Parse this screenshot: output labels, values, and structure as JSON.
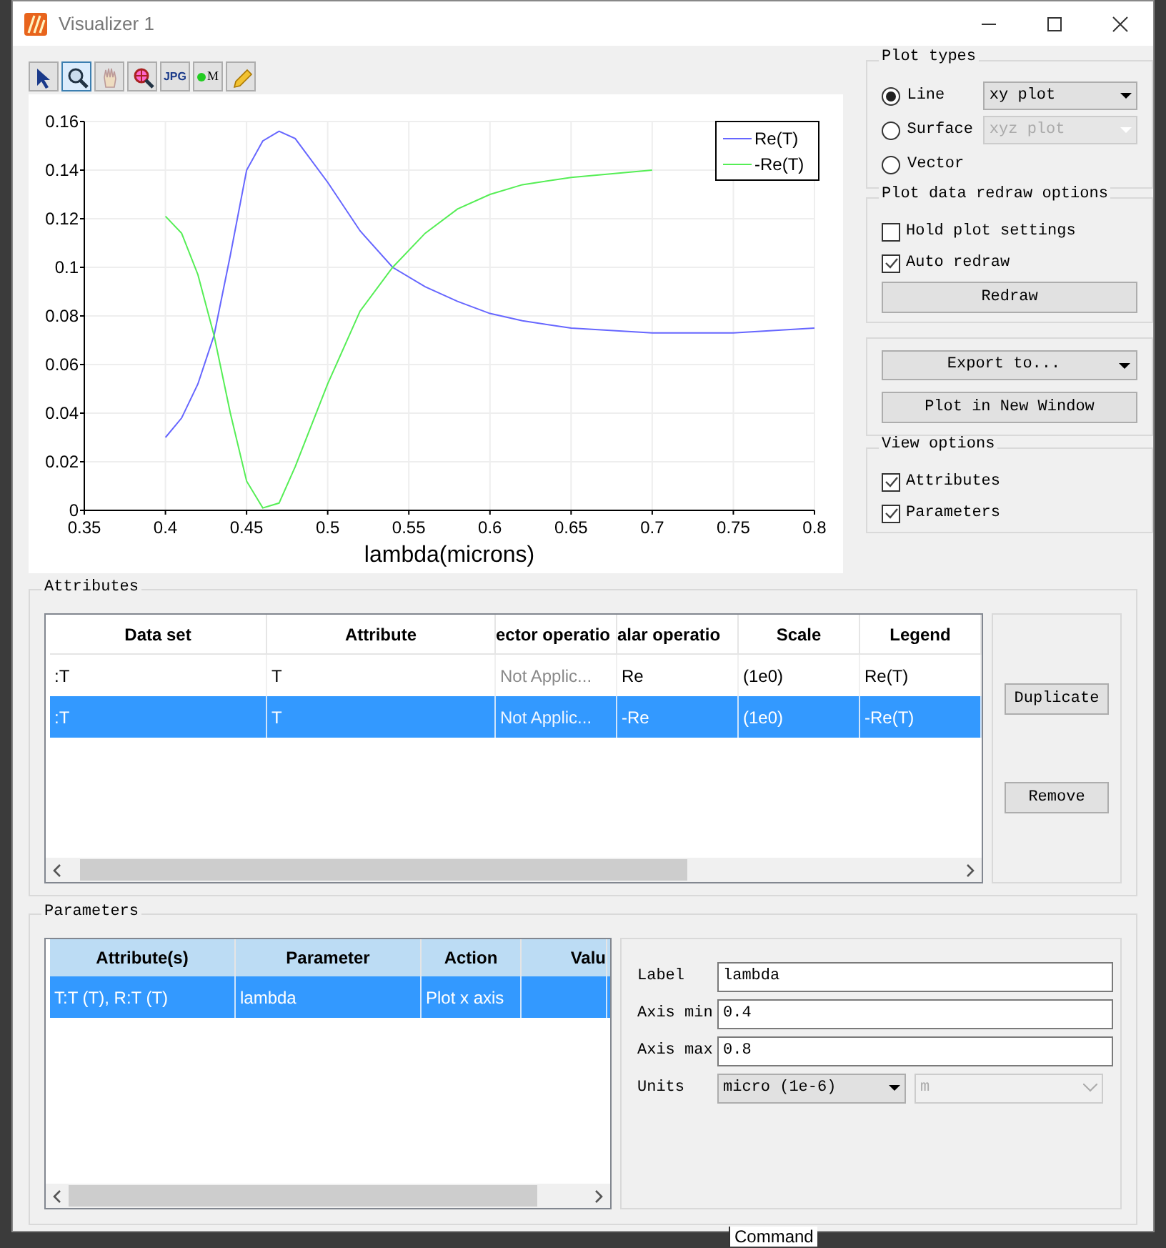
{
  "window": {
    "title": "Visualizer 1"
  },
  "toolbar": [
    {
      "kind": "pointer",
      "selected": false
    },
    {
      "kind": "zoom",
      "selected": true
    },
    {
      "kind": "pan",
      "selected": false
    },
    {
      "kind": "zoom-point",
      "selected": false
    },
    {
      "kind": "jpg",
      "label": "JPG",
      "selected": false
    },
    {
      "kind": "marker",
      "label": "M",
      "selected": false
    },
    {
      "kind": "pencil",
      "selected": false
    }
  ],
  "chart": {
    "chart_data": {
      "type": "line",
      "grid": true,
      "legend": true,
      "xlabel": "lambda(microns)",
      "xlim": [
        0.35,
        0.8
      ],
      "ylim": [
        0,
        0.16
      ],
      "xticks": [
        0.35,
        0.4,
        0.45,
        0.5,
        0.55,
        0.6,
        0.65,
        0.7,
        0.75,
        0.8
      ],
      "yticks": [
        0,
        0.02,
        0.04,
        0.06,
        0.08,
        0.1,
        0.12,
        0.14,
        0.16
      ],
      "x": [
        0.4,
        0.41,
        0.42,
        0.43,
        0.44,
        0.45,
        0.46,
        0.47,
        0.48,
        0.5,
        0.52,
        0.54,
        0.56,
        0.58,
        0.6,
        0.62,
        0.65,
        0.7,
        0.75,
        0.8
      ],
      "series": [
        {
          "name": "Re(T)",
          "color": "#6666ff",
          "values": [
            0.03,
            0.038,
            0.052,
            0.072,
            0.105,
            0.14,
            0.152,
            0.156,
            0.153,
            0.135,
            0.115,
            0.1,
            0.092,
            0.086,
            0.081,
            0.078,
            0.075,
            0.073,
            0.073,
            0.075
          ]
        },
        {
          "name": "-Re(T)",
          "color": "#55ee55",
          "values": [
            0.121,
            0.114,
            0.097,
            0.072,
            0.04,
            0.012,
            0.001,
            0.003,
            0.018,
            0.052,
            0.082,
            0.1,
            0.114,
            0.124,
            0.13,
            0.134,
            0.137,
            0.14,
            null,
            null
          ]
        }
      ]
    }
  },
  "plot_types": {
    "title": "Plot types",
    "options": [
      {
        "label": "Line",
        "selected": true,
        "dropdown": {
          "value": "xy plot",
          "disabled": false
        }
      },
      {
        "label": "Surface",
        "selected": false,
        "dropdown": {
          "value": "xyz plot",
          "disabled": true
        }
      },
      {
        "label": "Vector",
        "selected": false
      }
    ]
  },
  "redraw_options": {
    "title": "Plot data redraw options",
    "checkboxes": [
      {
        "label": "Hold plot settings",
        "checked": false
      },
      {
        "label": "Auto redraw",
        "checked": true
      }
    ],
    "button": "Redraw"
  },
  "export": {
    "dropdown": "Export to...",
    "button": "Plot in New Window"
  },
  "view_options": {
    "title": "View options",
    "checkboxes": [
      {
        "label": "Attributes",
        "checked": true
      },
      {
        "label": "Parameters",
        "checked": true
      }
    ]
  },
  "attributes": {
    "title": "Attributes",
    "columns": [
      "Data set",
      "Attribute",
      "ector operatio",
      "alar operatio",
      "Scale",
      "Legend"
    ],
    "rows": [
      {
        "selected": false,
        "cells": [
          {
            "text": ":T",
            "disabled": false
          },
          {
            "text": "T",
            "disabled": false
          },
          {
            "text": "Not Applic...",
            "disabled": true
          },
          {
            "text": "Re",
            "disabled": false
          },
          {
            "text": "(1e0)",
            "disabled": false
          },
          {
            "text": "Re(T)",
            "disabled": false
          }
        ]
      },
      {
        "selected": true,
        "cells": [
          {
            "text": ":T",
            "disabled": false
          },
          {
            "text": "T",
            "disabled": false
          },
          {
            "text": "Not Applic...",
            "disabled": true
          },
          {
            "text": "-Re",
            "disabled": false
          },
          {
            "text": "(1e0)",
            "disabled": false
          },
          {
            "text": "-Re(T)",
            "disabled": false
          }
        ]
      }
    ],
    "buttons": [
      "Duplicate",
      "Remove"
    ]
  },
  "parameters": {
    "title": "Parameters",
    "columns": [
      "Attribute(s)",
      "Parameter",
      "Action",
      "Valu"
    ],
    "rows": [
      {
        "selected": true,
        "cells": [
          "T:T (T), R:T (T)",
          "lambda",
          "Plot x axis"
        ]
      }
    ],
    "fields": [
      {
        "label": "Label",
        "value": "lambda"
      },
      {
        "label": "Axis min",
        "value": "0.4"
      },
      {
        "label": "Axis max",
        "value": "0.8"
      }
    ],
    "units": {
      "label": "Units",
      "value": "micro (1e-6)",
      "unit": "m"
    }
  },
  "background": {
    "text": "Command"
  }
}
